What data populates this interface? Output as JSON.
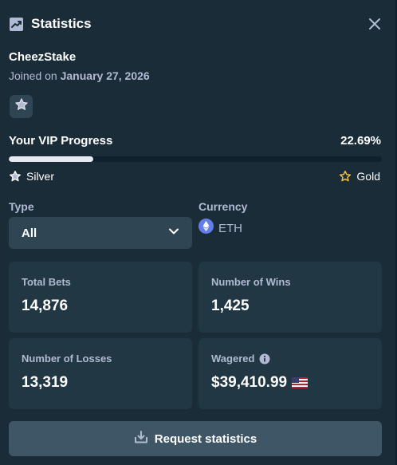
{
  "header": {
    "title": "Statistics",
    "title_icon": "chart-icon",
    "close_icon": "close-icon"
  },
  "user": {
    "name": "CheezStake",
    "joined_prefix": "Joined on",
    "joined_date": "January 27, 2026",
    "rank_icon": "star-icon"
  },
  "vip": {
    "label": "Your VIP Progress",
    "value_text": "22.69%",
    "progress_percent": 22.69,
    "current_tier": "Silver",
    "next_tier": "Gold"
  },
  "filters": {
    "type_label": "Type",
    "type_value": "All",
    "currency_label": "Currency",
    "currency_value": "ETH"
  },
  "stats": {
    "total_bets_label": "Total Bets",
    "total_bets_value": "14,876",
    "wins_label": "Number of Wins",
    "wins_value": "1,425",
    "losses_label": "Number of Losses",
    "losses_value": "13,319",
    "wagered_label": "Wagered",
    "wagered_value": "$39,410.99"
  },
  "actions": {
    "request_label": "Request statistics"
  },
  "colors": {
    "background": "#1a2c38",
    "card": "#213743",
    "input": "#2f4553",
    "button": "#3e5666",
    "muted_text": "#b1bad3",
    "gold": "#f3c34d",
    "eth": "#627eea"
  }
}
